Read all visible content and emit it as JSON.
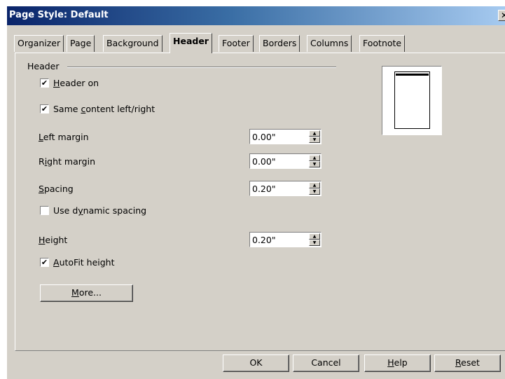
{
  "window": {
    "title": "Page Style: Default",
    "close_glyph": "✕"
  },
  "tabs": [
    {
      "label": "Organizer"
    },
    {
      "label": "Page"
    },
    {
      "label": "Background"
    },
    {
      "label": "Header",
      "active": true
    },
    {
      "label": "Footer"
    },
    {
      "label": "Borders"
    },
    {
      "label": "Columns"
    },
    {
      "label": "Footnote"
    }
  ],
  "header_group": {
    "title": "Header",
    "header_on": {
      "checked": true,
      "pre": "",
      "u": "H",
      "post": "eader on"
    },
    "same_content": {
      "checked": true,
      "pre": "Same ",
      "u": "c",
      "post": "ontent left/right"
    },
    "left_margin": {
      "pre": "",
      "u": "L",
      "post": "eft margin",
      "value": "0.00\""
    },
    "right_margin": {
      "pre": "R",
      "u": "i",
      "post": "ght margin",
      "value": "0.00\""
    },
    "spacing": {
      "pre": "",
      "u": "S",
      "post": "pacing",
      "value": "0.20\""
    },
    "dynamic_spacing": {
      "checked": false,
      "pre": "Use d",
      "u": "y",
      "post": "namic spacing"
    },
    "height": {
      "pre": "",
      "u": "H",
      "post": "eight",
      "value": "0.20\""
    },
    "autofit": {
      "checked": true,
      "pre": "",
      "u": "A",
      "post": "utoFit height"
    },
    "more_button": {
      "pre": "",
      "u": "M",
      "post": "ore..."
    }
  },
  "buttons": {
    "ok": {
      "pre": "OK",
      "u": "",
      "post": ""
    },
    "cancel": {
      "pre": "Cancel",
      "u": "",
      "post": ""
    },
    "help": {
      "pre": "",
      "u": "H",
      "post": "elp"
    },
    "reset": {
      "pre": "",
      "u": "R",
      "post": "eset"
    }
  },
  "colors": {
    "title_gradient_start": "#0a246a",
    "title_gradient_end": "#a6caf0",
    "dialog_bg": "#d4d0c8"
  }
}
